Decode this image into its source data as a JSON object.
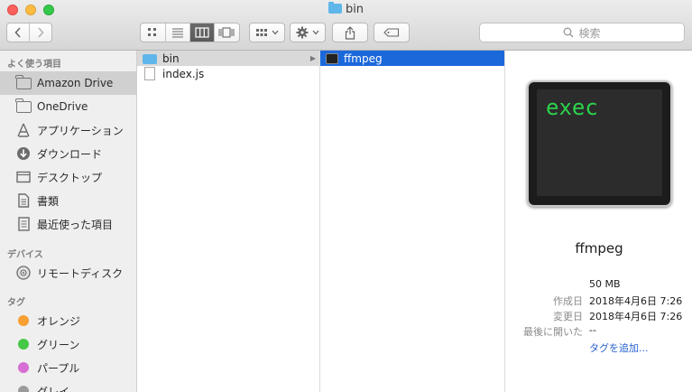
{
  "window": {
    "title": "bin"
  },
  "search": {
    "placeholder": "検索"
  },
  "sidebar": {
    "favorites_header": "よく使う項目",
    "favorites": [
      {
        "label": "Amazon Drive",
        "icon": "folder-icon",
        "selected": true
      },
      {
        "label": "OneDrive",
        "icon": "folder-icon"
      },
      {
        "label": "アプリケーション",
        "icon": "applications-icon"
      },
      {
        "label": "ダウンロード",
        "icon": "download-icon"
      },
      {
        "label": "デスクトップ",
        "icon": "desktop-icon"
      },
      {
        "label": "書類",
        "icon": "documents-icon"
      },
      {
        "label": "最近使った項目",
        "icon": "recents-icon"
      }
    ],
    "devices_header": "デバイス",
    "devices": [
      {
        "label": "リモートディスク",
        "icon": "remote-disc-icon"
      }
    ],
    "tags_header": "タグ",
    "tags": [
      {
        "label": "オレンジ",
        "color": "#f7a033"
      },
      {
        "label": "グリーン",
        "color": "#45c846"
      },
      {
        "label": "パープル",
        "color": "#d76ed4"
      },
      {
        "label": "グレイ",
        "color": "#9b9b9b"
      }
    ]
  },
  "columns": {
    "col1": [
      {
        "name": "bin",
        "type": "folder"
      },
      {
        "name": "index.js",
        "type": "document"
      }
    ],
    "col2": [
      {
        "name": "ffmpeg",
        "type": "executable"
      }
    ]
  },
  "preview": {
    "icon_text": "exec",
    "name": "ffmpeg",
    "size": "50 MB",
    "created_label": "作成日",
    "created": "2018年4月6日 7:26",
    "modified_label": "変更日",
    "modified": "2018年4月6日 7:26",
    "last_opened_label": "最後に開いた",
    "last_opened": "--",
    "add_tags": "タグを追加..."
  }
}
